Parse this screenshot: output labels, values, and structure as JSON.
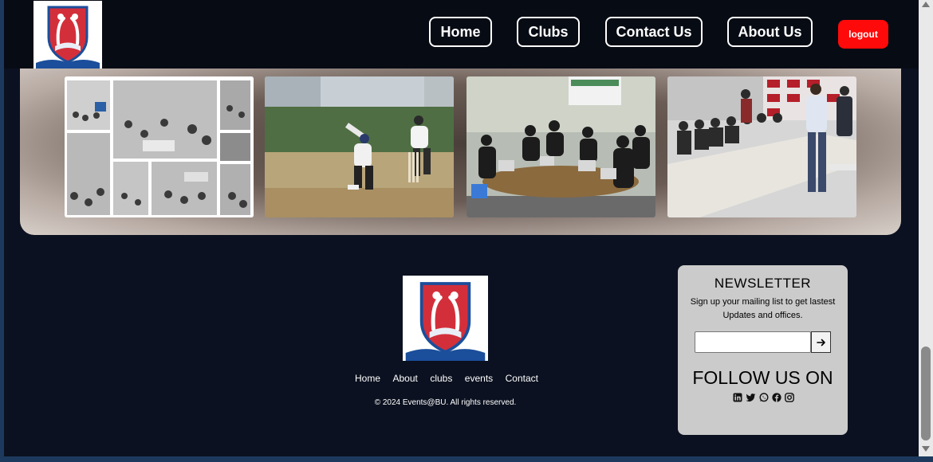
{
  "nav": {
    "items": [
      {
        "label": "Home"
      },
      {
        "label": "Clubs"
      },
      {
        "label": "Contact Us"
      },
      {
        "label": "About Us"
      }
    ],
    "logout_label": "logout"
  },
  "gallery": {
    "photos": [
      {
        "icon": "lecture-collage-photo"
      },
      {
        "icon": "cricket-photo"
      },
      {
        "icon": "hackathon-photo"
      },
      {
        "icon": "seminar-photo"
      }
    ]
  },
  "footer": {
    "links": [
      {
        "label": "Home"
      },
      {
        "label": "About"
      },
      {
        "label": "clubs"
      },
      {
        "label": "events"
      },
      {
        "label": "Contact"
      }
    ],
    "copyright": "© 2024 Events@BU. All rights reserved."
  },
  "newsletter": {
    "title": "NEWSLETTER",
    "description": "Sign up your mailing list to get lastest Updates and offices.",
    "input_value": "",
    "submit_icon": "arrow-right-icon",
    "follow_title": "FOLLOW US ON",
    "social_icons": [
      "linkedin-icon",
      "twitter-icon",
      "whatsapp-icon",
      "facebook-icon",
      "instagram-icon"
    ]
  },
  "colors": {
    "background": "#0b1120",
    "header": "#070b14",
    "logout": "#ff0a0a",
    "card": "#cbcbcb",
    "shield_red": "#d32f3b",
    "shield_blue": "#1b4e9b"
  }
}
